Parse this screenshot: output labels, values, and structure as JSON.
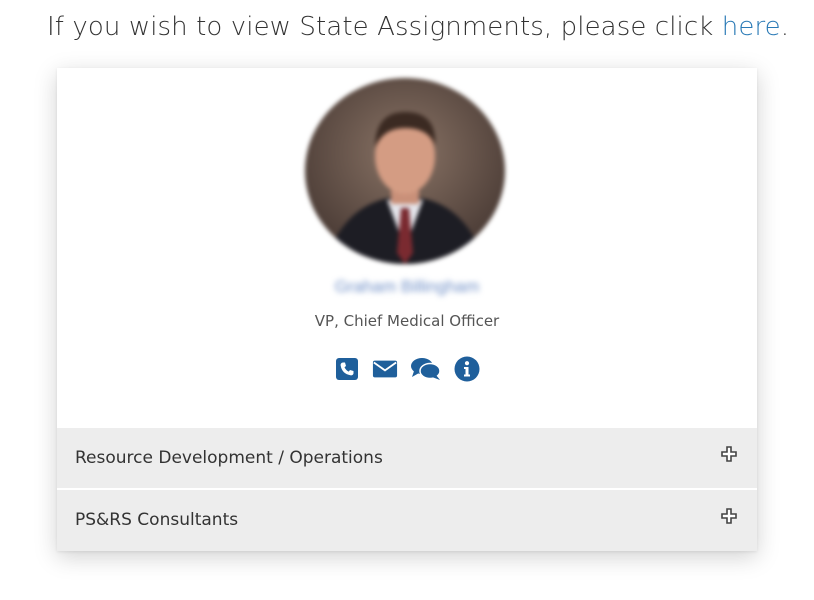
{
  "intro": {
    "prefix": "If you wish to view State Assignments, please click ",
    "link_text": "here",
    "suffix": "."
  },
  "profile": {
    "name": "Graham Billingham",
    "title": "VP, Chief Medical Officer",
    "icons": [
      "phone-icon",
      "envelope-icon",
      "chat-icon",
      "info-icon"
    ],
    "icon_color": "#1f5f9b"
  },
  "sections": [
    {
      "label": "Resource Development / Operations"
    },
    {
      "label": "PS&RS Consultants"
    }
  ],
  "colors": {
    "link": "#2a7ab6",
    "section_bg": "#ededed"
  }
}
